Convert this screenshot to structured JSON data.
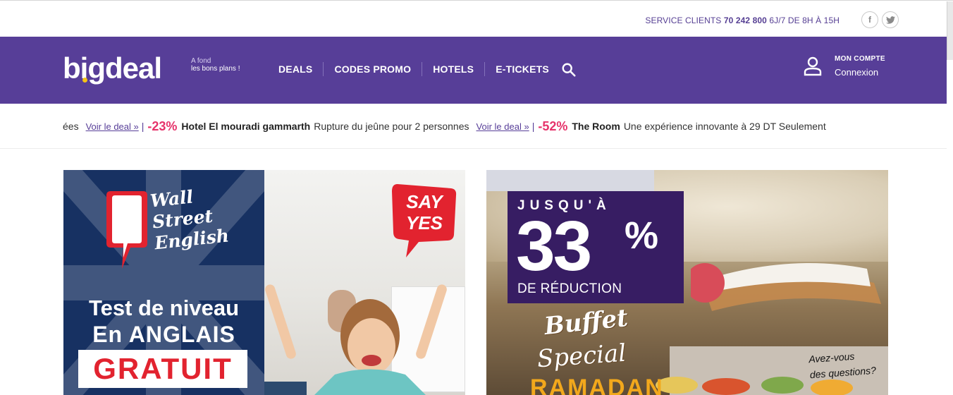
{
  "topbar": {
    "service_label": "SERVICE CLIENTS",
    "service_phone": "70 242 800",
    "service_hours": "6J/7 DE 8H À 15H",
    "social": [
      {
        "name": "facebook",
        "glyph": "f"
      },
      {
        "name": "twitter",
        "glyph": "t"
      }
    ]
  },
  "nav": {
    "logo": "bigdeal",
    "tagline_line1": "A fond",
    "tagline_line2": "les bons plans !",
    "menu": [
      "DEALS",
      "CODES PROMO",
      "HOTELS",
      "E-TICKETS"
    ],
    "account_title": "MON COMPTE",
    "account_link": "Connexion",
    "colors": {
      "brand": "#573e98",
      "accent": "#f6c416"
    }
  },
  "ticker": {
    "prefix": "ées",
    "items": [
      {
        "link": "Voir le deal »",
        "sep": "|",
        "pct": "-23%",
        "name": "Hotel El mouradi gammarth",
        "desc": "Rupture du jeûne pour 2 personnes"
      },
      {
        "link": "Voir le deal »",
        "sep": "|",
        "pct": "-52%",
        "name": "The Room",
        "desc": "Une expérience innovante à 29 DT Seulement"
      }
    ]
  },
  "banner1": {
    "brand": "Wall Street English",
    "brand_l1": "Wall",
    "brand_l2": "Street",
    "brand_l3": "English",
    "title1": "Test de niveau",
    "title2": "En ANGLAIS",
    "title3": "GRATUIT",
    "bubble_l1": "SAY",
    "bubble_l2": "YES"
  },
  "banner2": {
    "jusqua": "JUSQU'À",
    "pct": "33",
    "pct_sign": "%",
    "reduction": "DE RÉDUCTION",
    "buffet": "Buffet",
    "special": "Special",
    "ramadan": "RAMADAN",
    "question_l1": "Avez-vous",
    "question_l2": "des questions?"
  }
}
